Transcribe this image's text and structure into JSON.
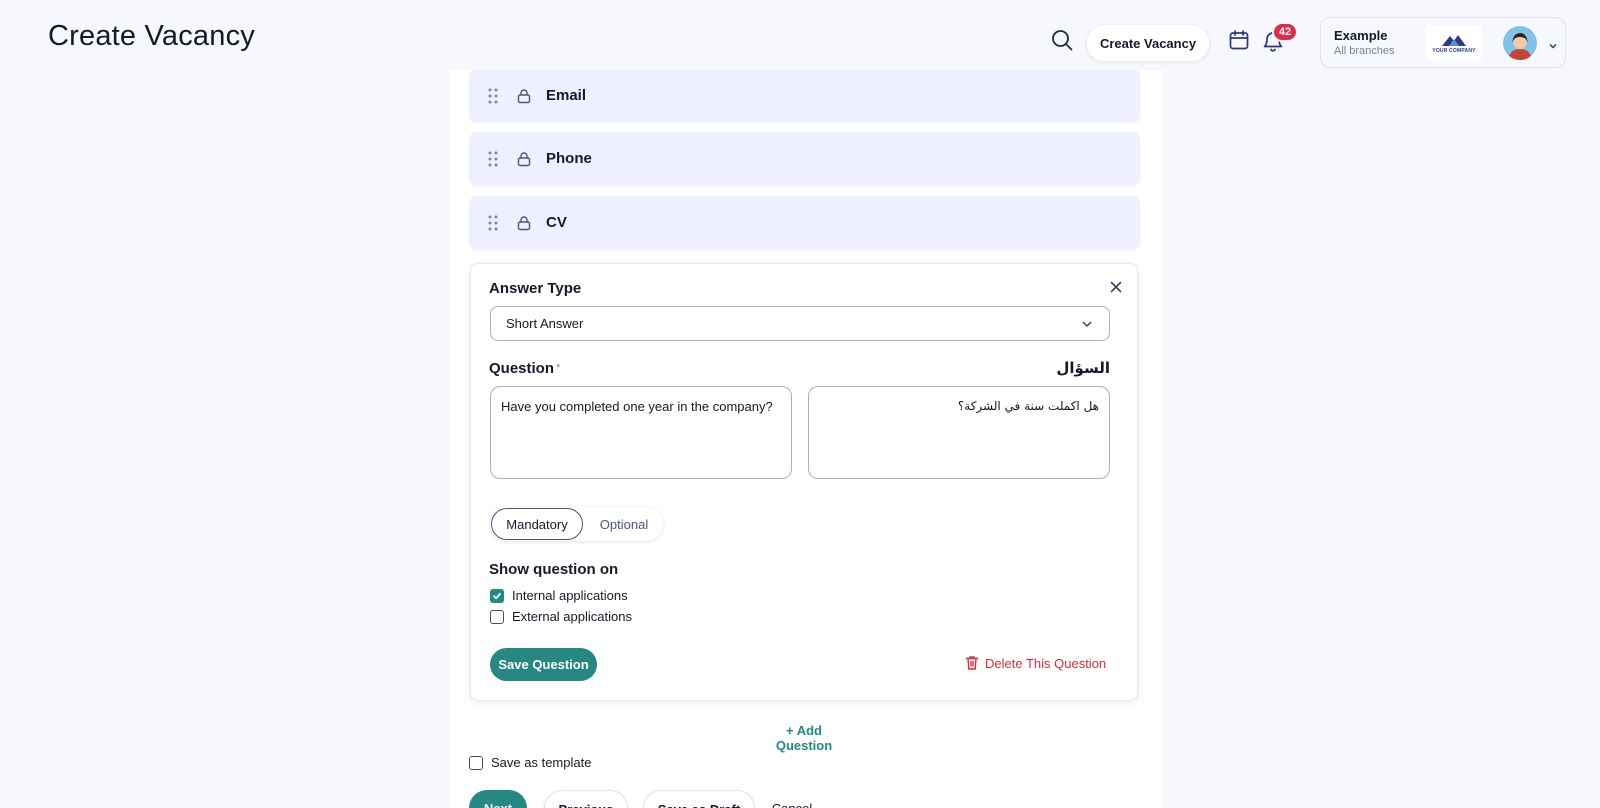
{
  "header": {
    "title": "Create Vacancy",
    "create_button": "Create Vacancy",
    "notification_count": "42",
    "account_name": "Example",
    "account_scope": "All branches",
    "logo_text": "YOUR COMPANY"
  },
  "fields": [
    {
      "label": "Email"
    },
    {
      "label": "Phone"
    },
    {
      "label": "CV"
    }
  ],
  "question_card": {
    "answer_type_label": "Answer Type",
    "answer_type_value": "Short Answer",
    "question_label": "Question",
    "required_mark": "*",
    "question_label_ar": "السؤال",
    "question_en": "Have you completed one year in the company?",
    "question_ar": "هل اكملت سنة في الشركة؟",
    "segment": {
      "mandatory": "Mandatory",
      "optional": "Optional",
      "selected": "Mandatory"
    },
    "show_on_label": "Show question on",
    "show_on_options": [
      {
        "label": "Internal applications",
        "checked": true
      },
      {
        "label": "External applications",
        "checked": false
      }
    ],
    "save_button": "Save Question",
    "delete_button": "Delete This Question"
  },
  "add_question": "+ Add Question",
  "save_template": {
    "label": "Save as template",
    "checked": false
  },
  "footer": {
    "next": "Next",
    "previous": "Previous",
    "save_draft": "Save as Draft",
    "cancel": "Cancel"
  },
  "colors": {
    "accent": "#268883",
    "danger": "#d3303e",
    "badge": "#dc2f45",
    "field_bg": "#eef0fd"
  },
  "icons": [
    "search-icon",
    "calendar-icon",
    "bell-icon",
    "chevron-down-icon",
    "drag-handle-icon",
    "lock-icon",
    "close-icon",
    "checkmark-icon",
    "trash-icon"
  ]
}
